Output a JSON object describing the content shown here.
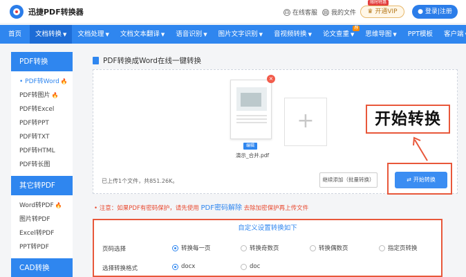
{
  "header": {
    "logo_text": "迅捷PDF转换器",
    "help_label": "在线客服",
    "docs_label": "我的文件",
    "vip_label": "开通VIP",
    "vip_badge": "限时特惠",
    "login_label": "登录|注册"
  },
  "nav": {
    "items": [
      {
        "label": "首页"
      },
      {
        "label": "文档转换"
      },
      {
        "label": "文档处理"
      },
      {
        "label": "文档文本翻译"
      },
      {
        "label": "语音识别"
      },
      {
        "label": "图片文字识别"
      },
      {
        "label": "音视频转换"
      },
      {
        "label": "论文查重"
      },
      {
        "label": "思维导图"
      },
      {
        "label": "PPT模板"
      },
      {
        "label": "客户端"
      }
    ],
    "caret": "▼",
    "badge": "荐"
  },
  "sidebar": {
    "pdf_head": "PDF转换",
    "pdf_items": [
      {
        "label": "PDF转Word"
      },
      {
        "label": "PDF转图片"
      },
      {
        "label": "PDF转Excel"
      },
      {
        "label": "PDF转PPT"
      },
      {
        "label": "PDF转TXT"
      },
      {
        "label": "PDF转HTML"
      },
      {
        "label": "PDF转长图"
      }
    ],
    "other_head": "其它转PDF",
    "other_items": [
      {
        "label": "Word转PDF"
      },
      {
        "label": "图片转PDF"
      },
      {
        "label": "Excel转PDF"
      },
      {
        "label": "PPT转PDF"
      }
    ],
    "cad_head": "CAD转换",
    "fire": "🔥"
  },
  "main": {
    "title": "PDF转换成Word在线一键转换",
    "file_name": "演示_合并.pdf",
    "edit_label": "编辑",
    "add_symbol": "+",
    "delete_symbol": "×",
    "status": "已上传1个文件，共851.26K。",
    "continue_label": "继续添加（批量转换）",
    "start_label": "开始转换",
    "callout": "开始转换",
    "note_prefix": "• 注意：如果PDF有密码保护，请先使用",
    "note_link": "PDF密码解除",
    "note_suffix": "去除加密保护再上传文件"
  },
  "settings": {
    "title": "自定义设置转换如下",
    "page_label": "页码选择",
    "page_options": [
      {
        "label": "转换每一页",
        "selected": true
      },
      {
        "label": "转换奇数页",
        "selected": false
      },
      {
        "label": "转换偶数页",
        "selected": false
      },
      {
        "label": "指定页转换",
        "selected": false
      }
    ],
    "format_label": "选择转换格式",
    "format_options": [
      {
        "label": "docx",
        "selected": true
      },
      {
        "label": "doc",
        "selected": false
      }
    ]
  },
  "colors": {
    "primary": "#2f86ef",
    "highlight": "#e8573a",
    "warning": "#e94a30"
  }
}
